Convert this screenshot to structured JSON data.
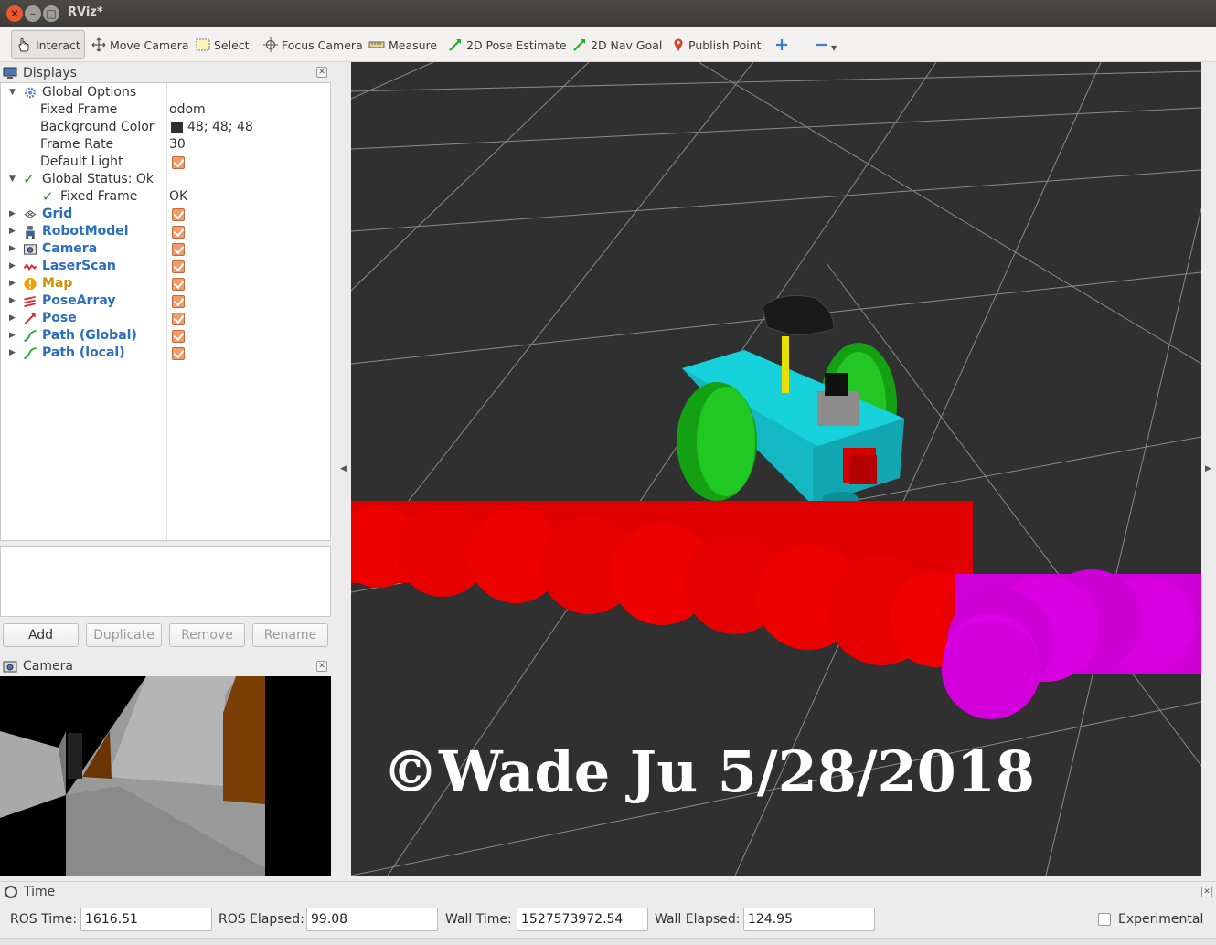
{
  "window": {
    "title": "RViz*"
  },
  "toolbar": {
    "tools": [
      {
        "label": "Interact",
        "icon": "hand-cursor-icon"
      },
      {
        "label": "Move Camera",
        "icon": "move-arrows-icon"
      },
      {
        "label": "Select",
        "icon": "selection-box-icon"
      },
      {
        "label": "Focus Camera",
        "icon": "crosshair-icon"
      },
      {
        "label": "Measure",
        "icon": "ruler-icon"
      },
      {
        "label": "2D Pose Estimate",
        "icon": "green-arrow-icon"
      },
      {
        "label": "2D Nav Goal",
        "icon": "green-arrow-icon"
      },
      {
        "label": "Publish Point",
        "icon": "map-pin-icon"
      }
    ]
  },
  "displays_panel": {
    "title": "Displays",
    "rows": [
      {
        "label": "Global Options",
        "value": ""
      },
      {
        "label": "Fixed Frame",
        "value": "odom"
      },
      {
        "label": "Background Color",
        "value": "48; 48; 48"
      },
      {
        "label": "Frame Rate",
        "value": "30"
      },
      {
        "label": "Default Light",
        "value": ""
      },
      {
        "label": "Global Status: Ok",
        "value": ""
      },
      {
        "label": "Fixed Frame",
        "value": "OK"
      },
      {
        "label": "Grid",
        "value": ""
      },
      {
        "label": "RobotModel",
        "value": ""
      },
      {
        "label": "Camera",
        "value": ""
      },
      {
        "label": "LaserScan",
        "value": ""
      },
      {
        "label": "Map",
        "value": ""
      },
      {
        "label": "PoseArray",
        "value": ""
      },
      {
        "label": "Pose",
        "value": ""
      },
      {
        "label": "Path (Global)",
        "value": ""
      },
      {
        "label": "Path (local)",
        "value": ""
      }
    ],
    "buttons": {
      "add": "Add",
      "duplicate": "Duplicate",
      "remove": "Remove",
      "rename": "Rename"
    }
  },
  "camera_panel": {
    "title": "Camera"
  },
  "viewport": {
    "watermark": "©Wade Ju 5/28/2018",
    "background_color": "#303030"
  },
  "time_panel": {
    "title": "Time",
    "ros_time_label": "ROS Time:",
    "ros_time": "1616.51",
    "ros_elapsed_label": "ROS Elapsed:",
    "ros_elapsed": "99.08",
    "wall_time_label": "Wall Time:",
    "wall_time": "1527573972.54",
    "wall_elapsed_label": "Wall Elapsed:",
    "wall_elapsed": "124.95",
    "experimental_label": "Experimental"
  }
}
